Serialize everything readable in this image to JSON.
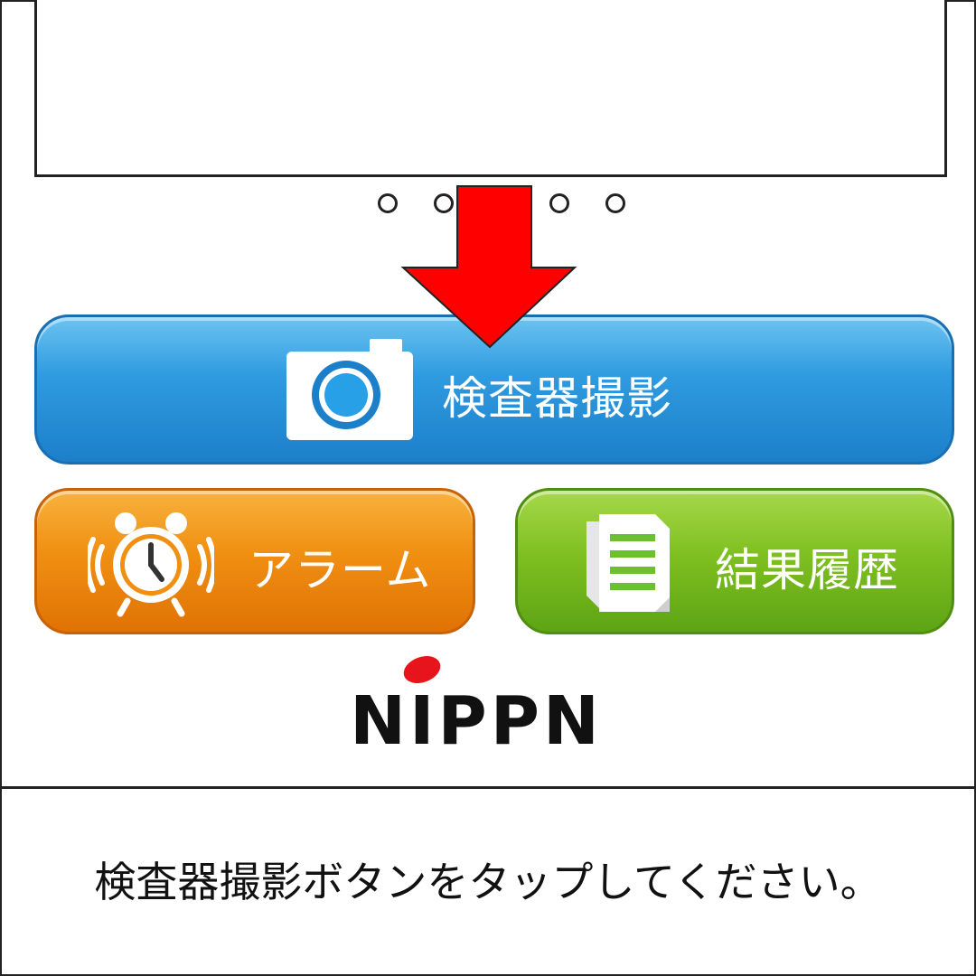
{
  "buttons": {
    "camera_label": "検査器撮影",
    "alarm_label": "アラーム",
    "history_label": "結果履歴"
  },
  "carousel": {
    "dot_count": 5
  },
  "logo": {
    "text": "NIPPN"
  },
  "instruction": {
    "text": "検査器撮影ボタンをタップしてください。"
  },
  "icons": {
    "camera": "camera-icon",
    "alarm": "alarm-clock-icon",
    "history": "document-icon",
    "pointer": "arrow-down-icon"
  },
  "colors": {
    "camera_button": "#2f9be0",
    "alarm_button": "#f08f12",
    "history_button": "#7fc021",
    "arrow": "#ff0000",
    "logo_dot": "#e8141b"
  }
}
